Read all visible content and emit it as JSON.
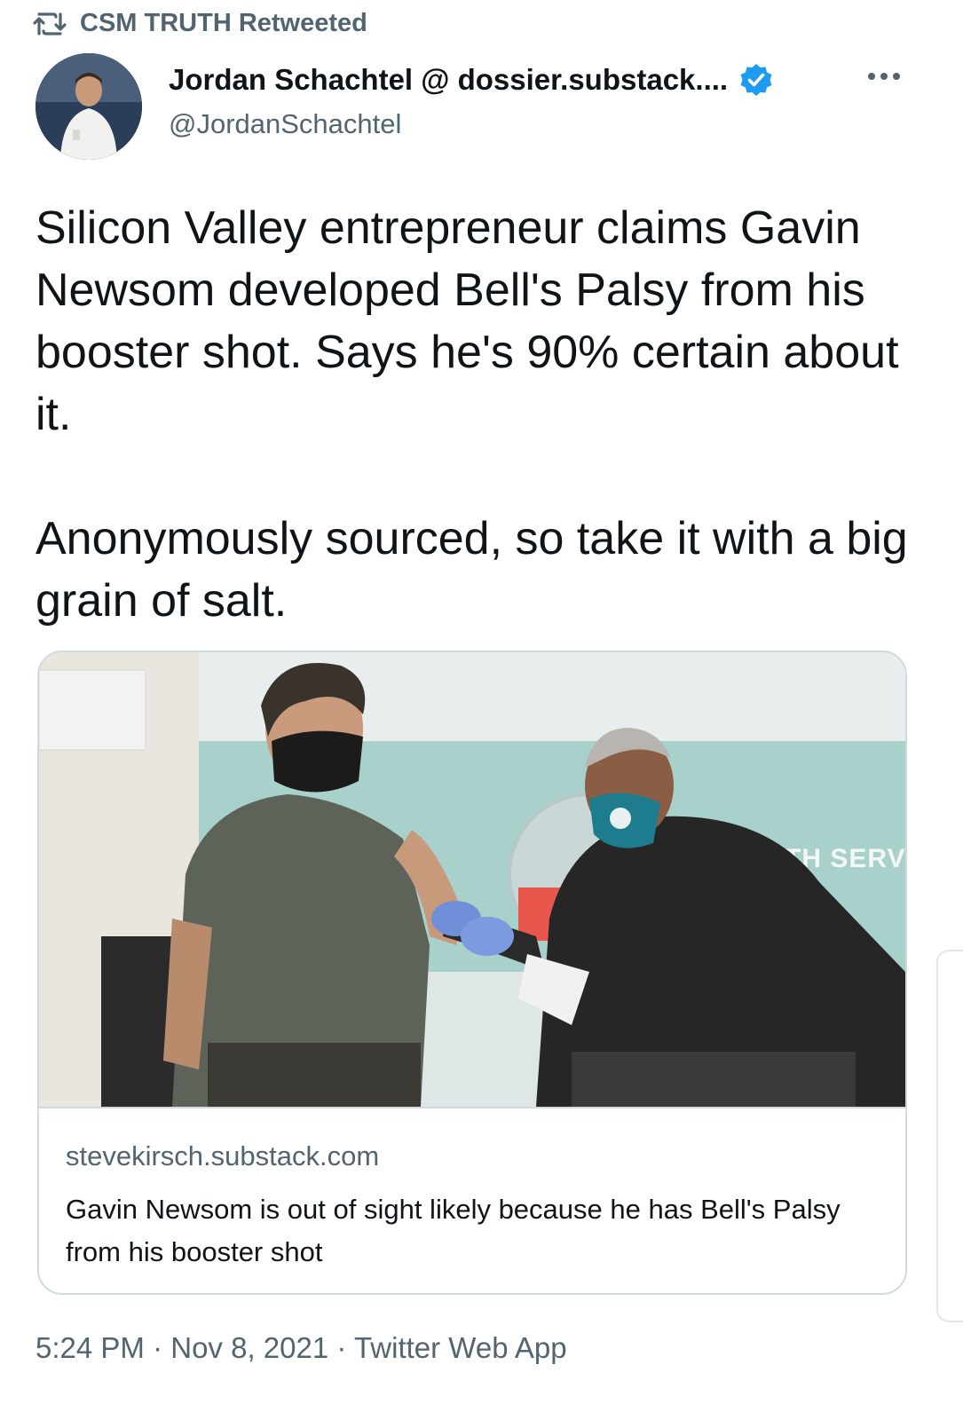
{
  "retweet": {
    "label": "CSM TRUTH Retweeted",
    "icon": "retweet-icon"
  },
  "author": {
    "name": "Jordan Schachtel @ dossier.substack....",
    "handle": "@JordanSchachtel",
    "verified": true,
    "verified_color": "#1d9bf0"
  },
  "tweet": {
    "paragraphs": [
      "Silicon Valley entrepreneur claims Gavin Newsom developed Bell's Palsy from his booster shot. Says he's 90% certain about it.",
      "Anonymously sourced, so take it with a big grain of salt."
    ]
  },
  "card": {
    "image_text": "TH SERVICE",
    "domain": "stevekirsch.substack.com",
    "title": "Gavin Newsom is out of sight likely because he has Bell's Palsy from his booster shot"
  },
  "meta": {
    "time": "5:24 PM",
    "date": "Nov 8, 2021",
    "source": "Twitter Web App",
    "separator": " · "
  },
  "colors": {
    "text_primary": "#0f1419",
    "text_secondary": "#536471",
    "border": "#cfd9de",
    "accent": "#1d9bf0"
  }
}
